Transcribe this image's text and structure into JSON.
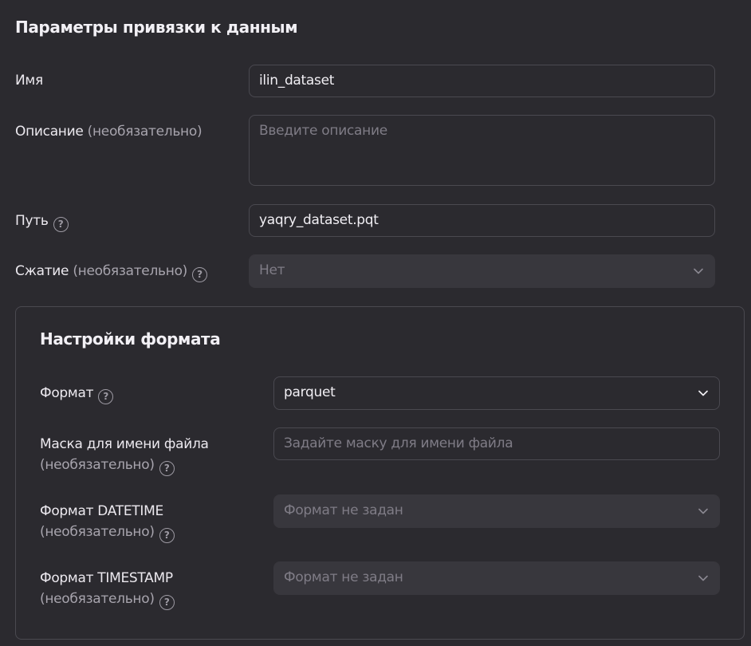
{
  "section": {
    "title": "Параметры привязки к данным"
  },
  "name_field": {
    "label": "Имя",
    "value": "ilin_dataset"
  },
  "description_field": {
    "label": "Описание",
    "optional": "(необязательно)",
    "placeholder": "Введите описание"
  },
  "path_field": {
    "label": "Путь",
    "value": "yaqry_dataset.pqt"
  },
  "compression_field": {
    "label": "Сжатие",
    "optional": "(необязательно)",
    "value": "Нет"
  },
  "format_panel": {
    "title": "Настройки формата",
    "format": {
      "label": "Формат",
      "value": "parquet"
    },
    "file_mask": {
      "label": "Маска для имени файла",
      "optional": "(необязательно)",
      "placeholder": "Задайте маску для имени файла"
    },
    "datetime_format": {
      "label": "Формат DATETIME",
      "optional": "(необязательно)",
      "placeholder": "Формат не задан"
    },
    "timestamp_format": {
      "label": "Формат TIMESTAMP",
      "optional": "(необязательно)",
      "placeholder": "Формат не задан"
    }
  },
  "icons": {
    "help": "question-circle-icon",
    "dropdown": "chevron-down-icon",
    "help_glyph": "?"
  },
  "colors": {
    "background": "#2b2a2f",
    "border": "#4a4950",
    "disabled_bg": "#38373d",
    "text": "#ece9ef",
    "muted_text": "#a7a4ad",
    "placeholder": "#7f7c86"
  }
}
